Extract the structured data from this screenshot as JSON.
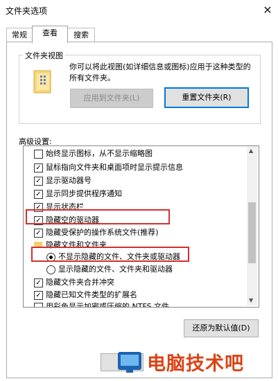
{
  "window": {
    "title": "文件夹选项"
  },
  "tabs": [
    {
      "label": "常规"
    },
    {
      "label": "查看"
    },
    {
      "label": "搜索"
    }
  ],
  "folder_views": {
    "group_label": "文件夹视图",
    "description": "你可以将此视图(如详细信息或图标)应用于这种类型的所有文件夹。",
    "apply_button": "应用到文件夹(L)",
    "reset_button": "重置文件夹(R)"
  },
  "advanced": {
    "label": "高级设置:",
    "items": [
      {
        "type": "checkbox",
        "checked": false,
        "text": "始终显示图标，从不显示缩略图"
      },
      {
        "type": "checkbox",
        "checked": true,
        "text": "鼠标指向文件夹和桌面项时显示提示信息"
      },
      {
        "type": "checkbox",
        "checked": true,
        "text": "显示驱动器号"
      },
      {
        "type": "checkbox",
        "checked": true,
        "text": "显示同步提供程序通知"
      },
      {
        "type": "checkbox",
        "checked": true,
        "text": "显示状态栏"
      },
      {
        "type": "checkbox",
        "checked": true,
        "text": "隐藏空的驱动器"
      },
      {
        "type": "checkbox",
        "checked": true,
        "text": "隐藏受保护的操作系统文件(推荐)"
      },
      {
        "type": "folder",
        "text": "隐藏文件和文件夹"
      },
      {
        "type": "radio",
        "checked": true,
        "text": "不显示隐藏的文件、文件夹或驱动器"
      },
      {
        "type": "radio",
        "checked": false,
        "text": "显示隐藏的文件、文件夹和驱动器"
      },
      {
        "type": "checkbox",
        "checked": true,
        "text": "隐藏文件夹合并冲突"
      },
      {
        "type": "checkbox",
        "checked": true,
        "text": "隐藏已知文件类型的扩展名"
      },
      {
        "type": "checkbox",
        "checked": false,
        "text": "用彩色显示加密或压缩的 NTFS 文件"
      }
    ],
    "restore_defaults": "还原为默认值(D)"
  },
  "icons": {
    "close": "close-icon",
    "folder": "folder-icon",
    "check": "checkmark-icon"
  },
  "watermark": {
    "text": "电脑技术吧"
  }
}
